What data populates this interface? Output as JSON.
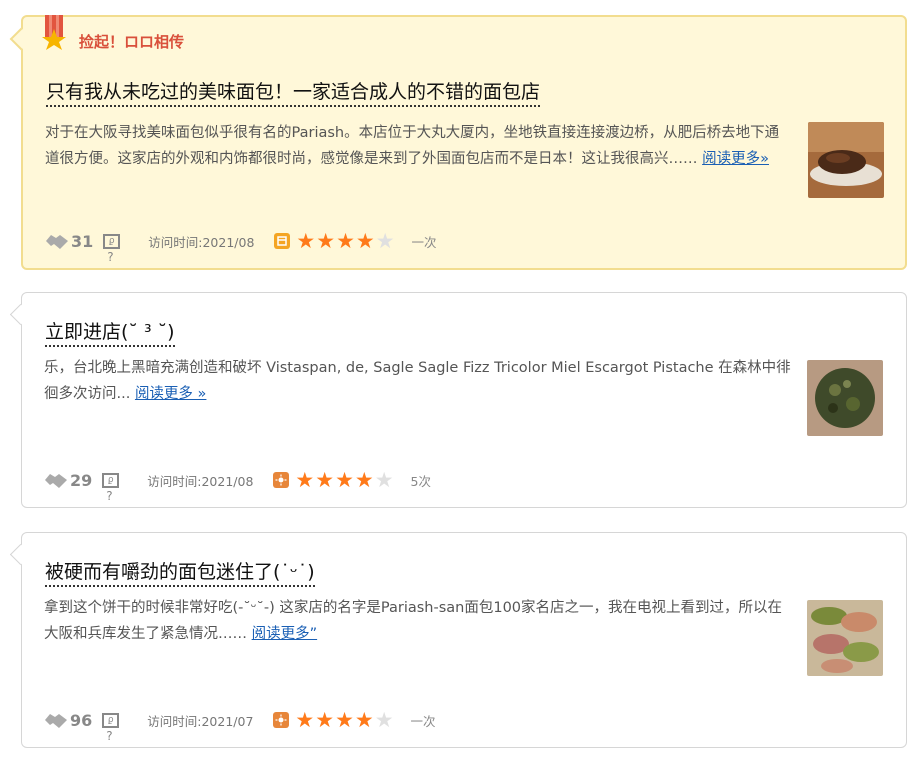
{
  "cards": [
    {
      "featured": true,
      "pick_label": "捡起！ロロ相传",
      "title": "只有我从未吃过的美味面包！一家适合成人的不错的面包店",
      "body": "对于在大阪寻找美味面包似乎很有名的Pariash。本店位于大丸大厦内，坐地铁直接连接渡边桥，从肥后桥去地下通道很方便。这家店的外观和内饰都很时尚，感觉像是来到了外国面包店而不是日本！这让我很高兴…… ",
      "more": "阅读更多»",
      "likes": "31",
      "visit": "访问时间:2021/08",
      "badge": "lunch",
      "rating": 4,
      "visit_count": "一次"
    },
    {
      "featured": false,
      "title": "立即进店(˘ ³ ˘)",
      "body": "乐，台北晚上黑暗充满创造和破坏 Vistaspan, de, Sagle Sagle Fizz Tricolor Miel Escargot Pistache 在森林中徘徊多次访问... ",
      "more": "阅读更多 »",
      "likes": "29",
      "visit": "访问时间:2021/08",
      "badge": "day",
      "rating": 4,
      "visit_count": "5次"
    },
    {
      "featured": false,
      "title": "被硬而有嚼劲的面包迷住了(˙ᵕ˙)",
      "body": "拿到这个饼干的时候非常好吃(-˘ᵕ˘-) 这家店的名字是Pariash-san面包100家名店之一，我在电视上看到过，所以在大阪和兵库发生了紧急情况…… ",
      "more": "阅读更多”",
      "likes": "96",
      "visit": "访问时间:2021/07",
      "badge": "day",
      "rating": 4,
      "visit_count": "一次"
    }
  ],
  "colors": {
    "star": "#ff7a1a",
    "link": "#1a5fb4",
    "pick": "#d9503b",
    "featured_bg": "#fff8d9"
  },
  "icons": {
    "like": "handshake-icon",
    "comment": "comment-icon",
    "ribbon": "ribbon-star-icon"
  }
}
